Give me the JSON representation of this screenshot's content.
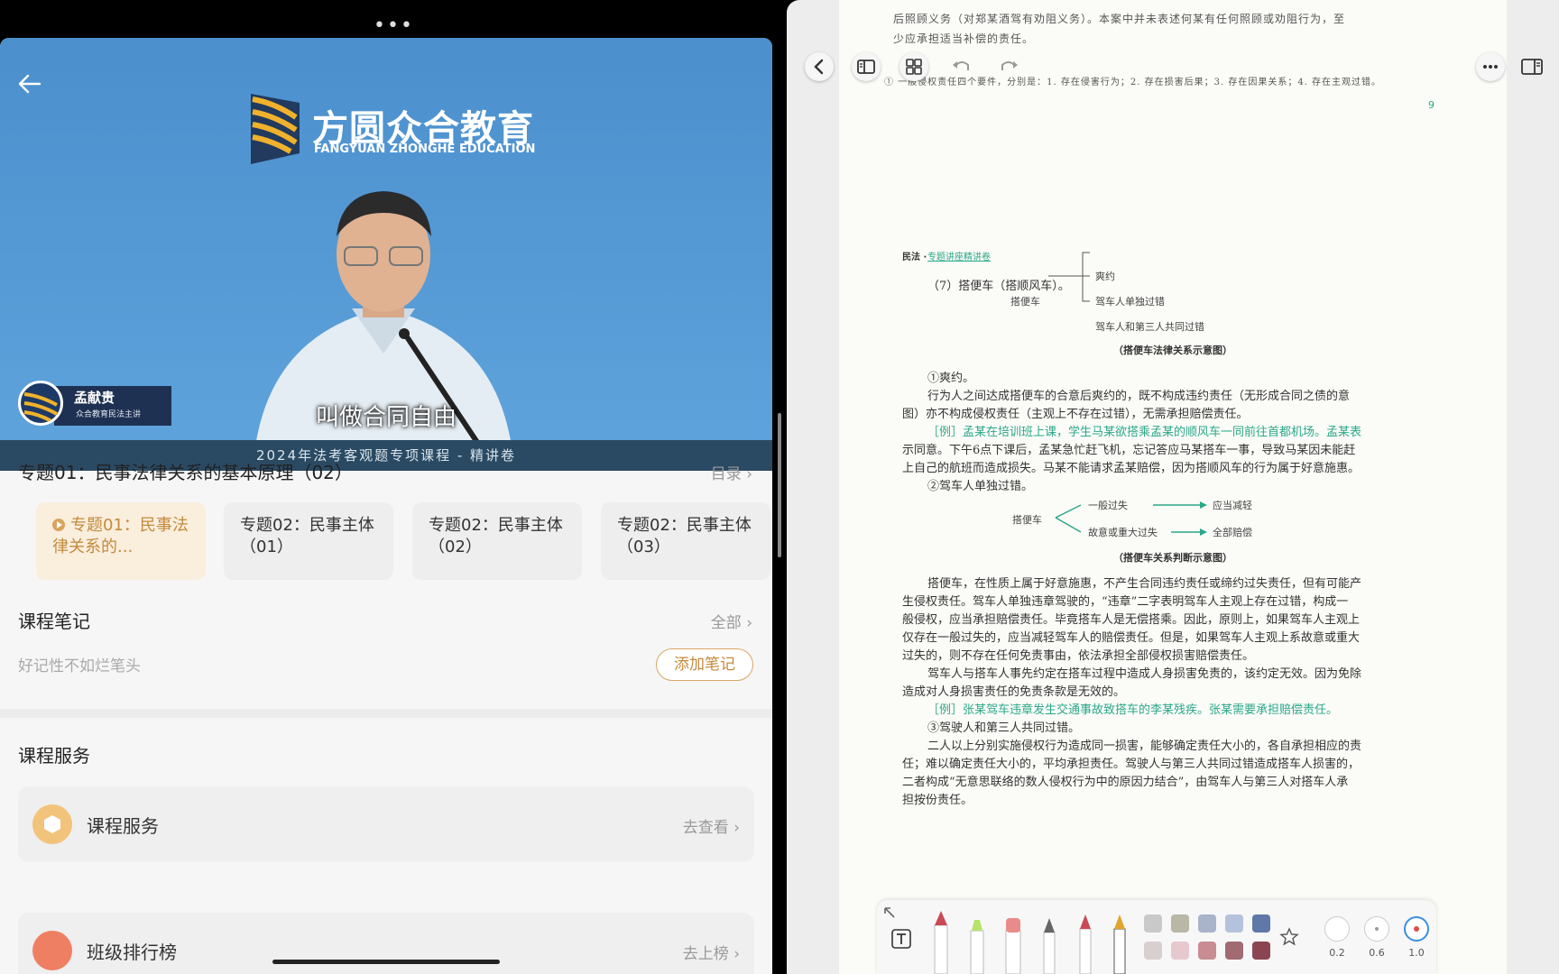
{
  "left": {
    "more_dots": "•••",
    "logo": {
      "cn": "方圆众合教育",
      "en": "FANGYUAN ZHONGHE EDUCATION"
    },
    "lecturer": {
      "name": "孟献贵",
      "role": "众合教育民法主讲"
    },
    "subtitle": "叫做合同自由",
    "banner": "2024年法考客观题专项课程 - 精讲卷",
    "course_title": "专题01：民事法律关系的基本原理（02）",
    "toc_label": "目录",
    "chapters": [
      {
        "label": "专题01：民事法律关系的..."
      },
      {
        "label": "专题02：民事主体（01）"
      },
      {
        "label": "专题02：民事主体（02）"
      },
      {
        "label": "专题02：民事主体（03）"
      }
    ],
    "notes": {
      "title": "课程笔记",
      "all": "全部",
      "placeholder": "好记性不如烂笔头",
      "add": "添加笔记"
    },
    "services": {
      "title": "课程服务",
      "item_label": "课程服务",
      "item_action": "去查看",
      "rank_label": "班级排行榜",
      "rank_action": "去上榜"
    },
    "chevron": "›"
  },
  "right": {
    "top_page": {
      "lines": [
        "后照顾义务（对郑某酒驾有劝阻义务）。本案中并未表述何某有任何照顾或劝阻行为，至",
        "少应承担适当补偿的责任。"
      ],
      "footnote": "① 一般侵权责任四个要件，分别是：1. 存在侵害行为；2. 存在损害后果；3. 存在因果关系；4. 存在主观过错。",
      "page_num": "9"
    },
    "header": {
      "left": "民法 ·",
      "right": "专题讲座精讲卷"
    },
    "section": "（7）搭便车（搭顺风车）。",
    "diagram1": {
      "root": "搭便车",
      "branches": [
        "爽约",
        "驾车人单独过错",
        "驾车人和第三人共同过错"
      ],
      "caption": "（搭便车法律关系示意图）"
    },
    "p1_head": "①爽约。",
    "p1": [
      "行为人之间达成搭便车的合意后爽约的，既不构成违约责任（无形成合同之债的意",
      "图）亦不构成侵权责任（主观上不存在过错），无需承担赔偿责任。"
    ],
    "ex1": [
      "［例］孟某在培训班上课，学生马某欲搭乘孟某的顺风车一同前往首都机场。孟某表",
      "示同意。下午6点下课后，孟某急忙赶飞机，忘记答应马某搭车一事，导致马某因未能赶",
      "上自己的航班而造成损失。马某不能请求孟某赔偿，因为搭顺风车的行为属于好意施惠。"
    ],
    "p2_head": "②驾车人单独过错。",
    "diagram2": {
      "root": "搭便车",
      "top": "一般过失",
      "top_result": "应当减轻",
      "bottom": "故意或重大过失",
      "bottom_result": "全部赔偿",
      "caption": "（搭便车关系判断示意图）"
    },
    "p3": [
      "搭便车，在性质上属于好意施惠，不产生合同违约责任或缔约过失责任，但有可能产",
      "生侵权责任。驾车人单独违章驾驶的，“违章”二字表明驾车人主观上存在过错，构成一",
      "般侵权，应当承担赔偿责任。毕竟搭车人是无偿搭乘。因此，原则上，如果驾车人主观上",
      "仅存在一般过失的，应当减轻驾车人的赔偿责任。但是，如果驾车人主观上系故意或重大",
      "过失的，则不存在任何免责事由，依法承担全部侵权损害赔偿责任。",
      "驾车人与搭车人事先约定在搭车过程中造成人身损害免责的，该约定无效。因为免除",
      "造成对人身损害责任的免责条款是无效的。"
    ],
    "ex2": "［例］张某驾车违章发生交通事故致搭车的李某残疾。张某需要承担赔偿责任。",
    "p4_head": "③驾驶人和第三人共同过错。",
    "p4": [
      "二人以上分别实施侵权行为造成同一损害，能够确定责任大小的，各自承担相应的责",
      "任；难以确定责任大小的，平均承担责任。驾驶人与第三人共同过错造成搭车人损害的，",
      "二者构成“无意思联络的数人侵权行为中的原因力结合”，由驾车人与第三人对搭车人承",
      "担按份责任。"
    ],
    "annotation": {
      "sizes": [
        "0.2",
        "0.6",
        "1.0"
      ]
    },
    "colors": {
      "swatches_top": [
        "#c9c9c9",
        "#b9b7a6",
        "#a9b3c9",
        "#b4c2dc",
        "#5f78a8"
      ],
      "swatches_bottom": [
        "#d8cfcf",
        "#e6c9cf",
        "#c98c93",
        "#a26b74",
        "#8b4552"
      ]
    }
  }
}
